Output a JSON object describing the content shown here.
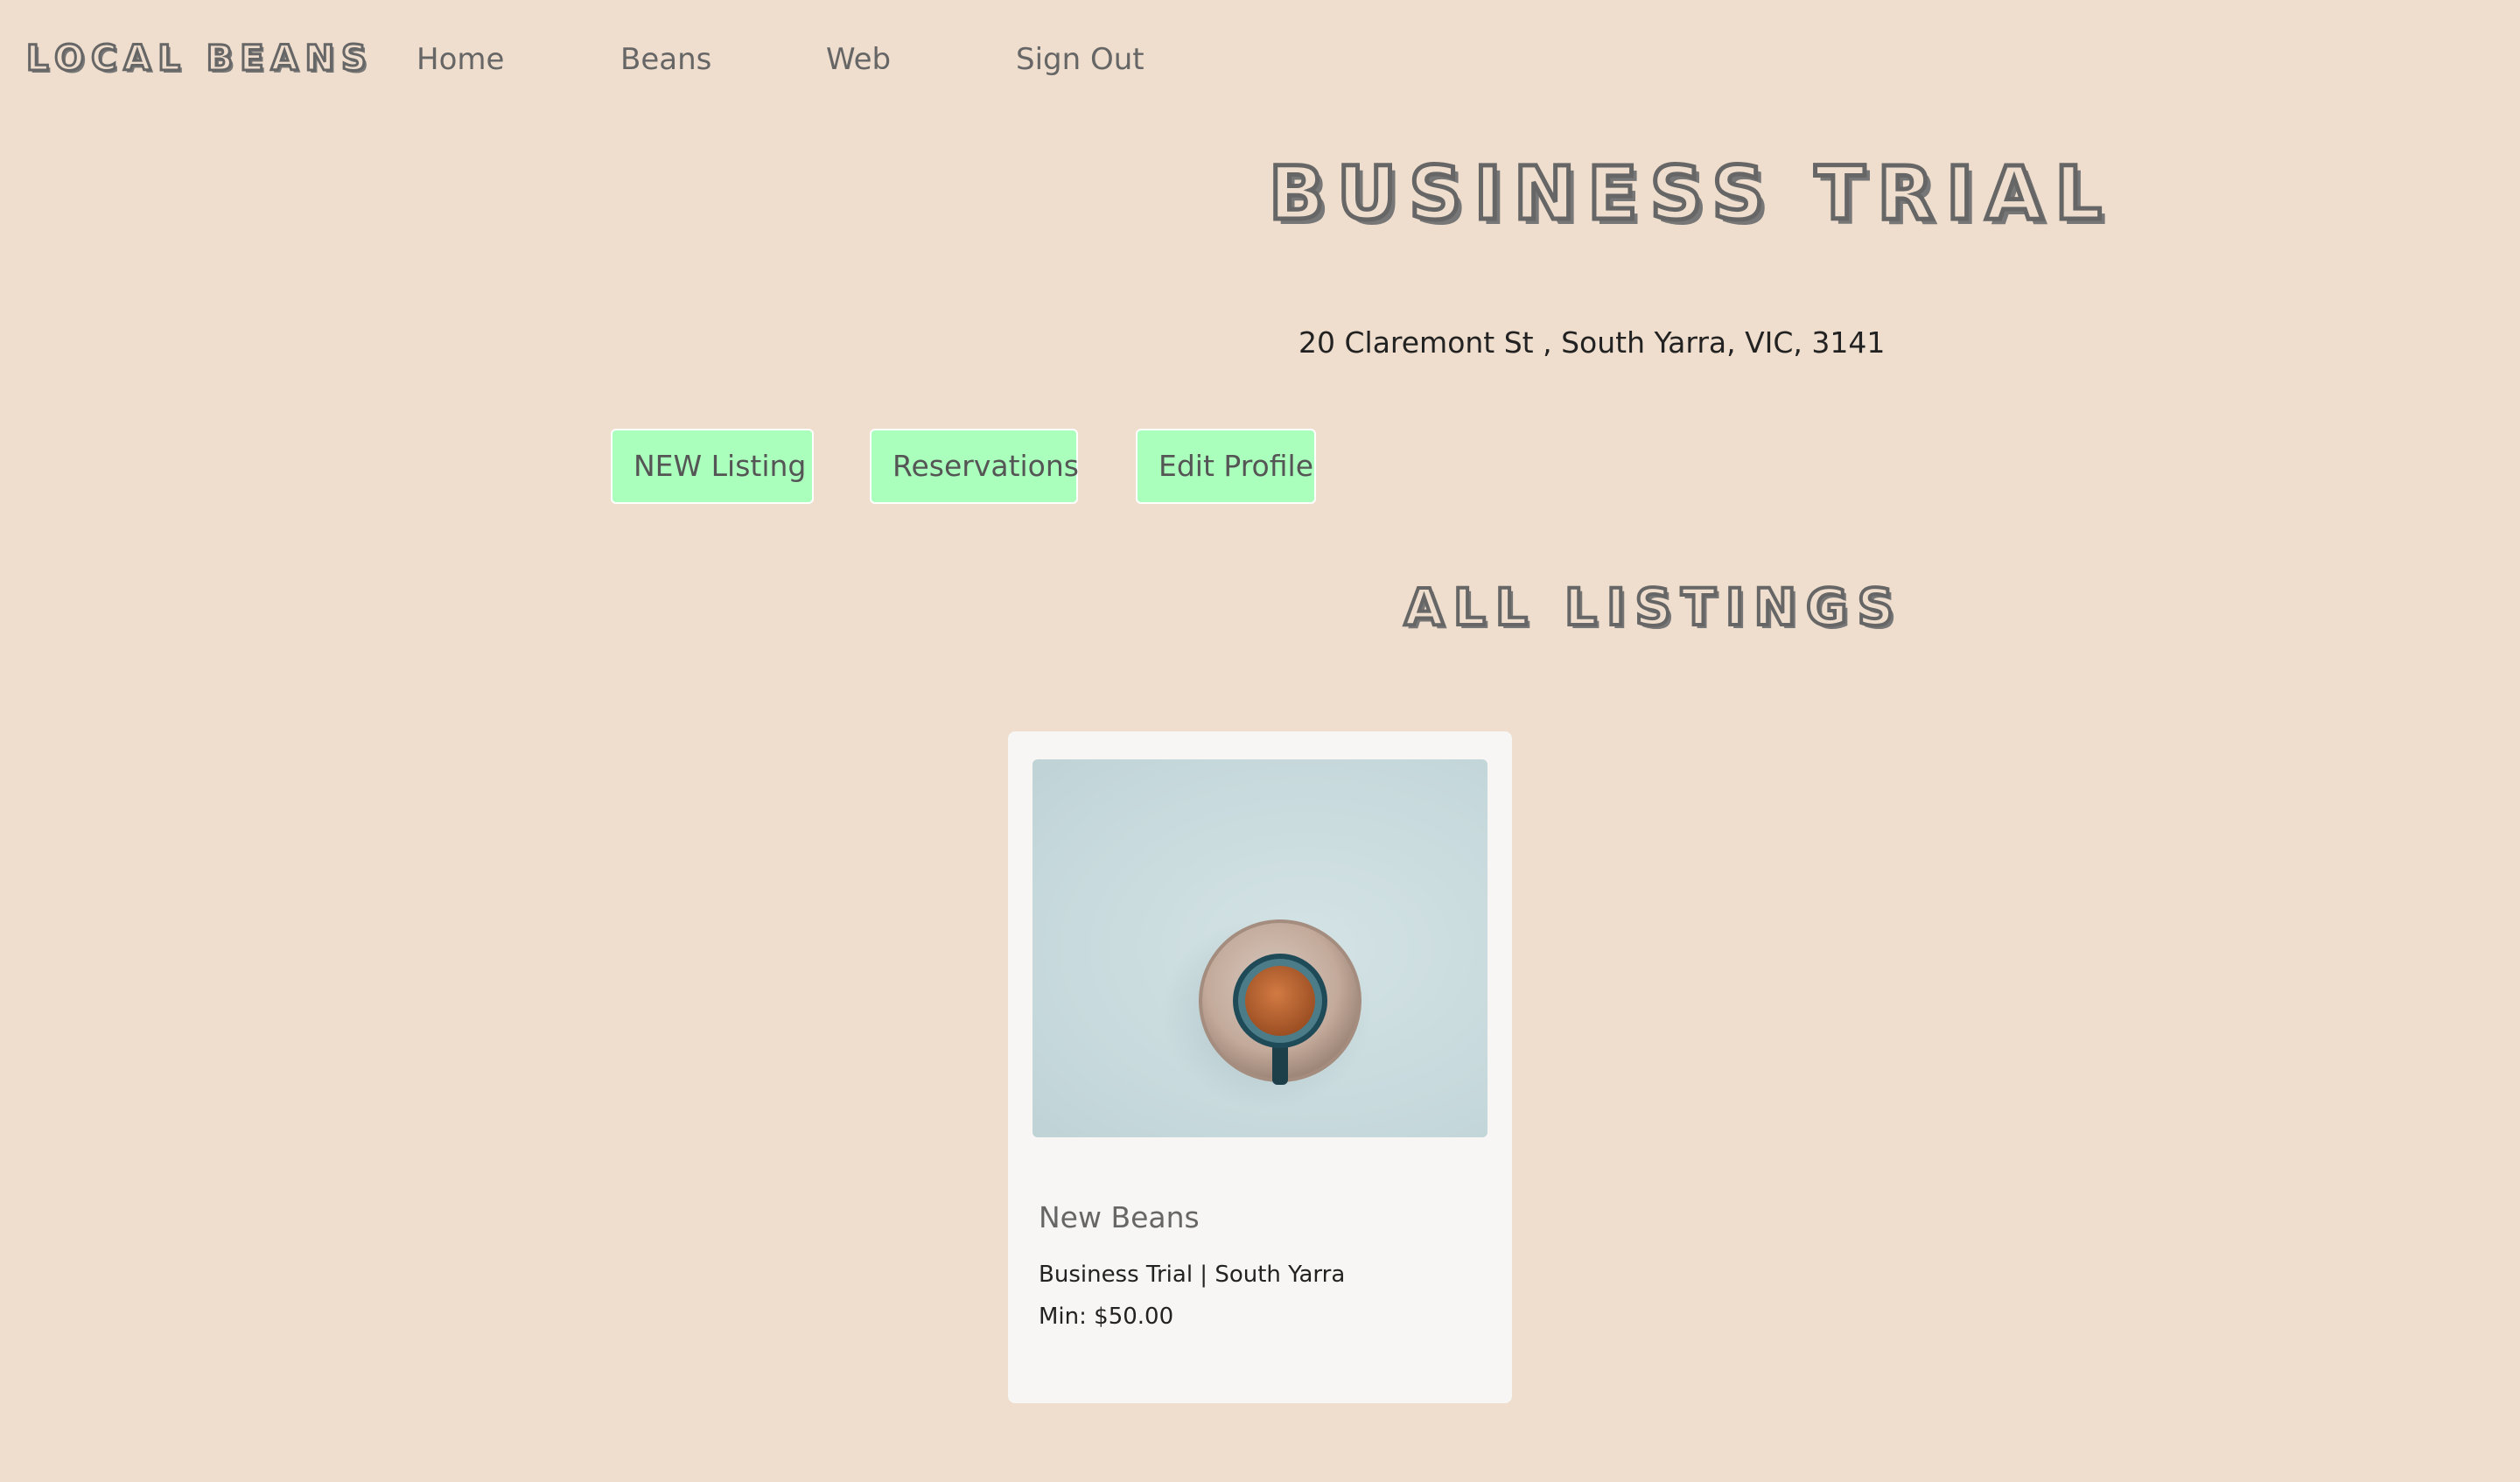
{
  "brand": {
    "logo_text": "Local Beans"
  },
  "nav": {
    "items": [
      {
        "label": "Home"
      },
      {
        "label": "Beans"
      },
      {
        "label": "Web"
      },
      {
        "label": "Sign Out"
      }
    ]
  },
  "business": {
    "title": "Business Trial",
    "address": "20 Claremont St , South Yarra, VIC, 3141"
  },
  "actions": {
    "new_listing": "NEW Listing",
    "reservations": "Reservations",
    "edit_profile": "Edit Profile"
  },
  "listings": {
    "heading": "All Listings",
    "items": [
      {
        "name": "New Beans",
        "subtitle": "Business Trial | South Yarra",
        "price": "Min: $50.00",
        "image_icon": "coffee-cup-icon"
      }
    ]
  },
  "colors": {
    "background": "#efdecd",
    "button": "#aaffbd",
    "card": "#f7f6f4"
  }
}
